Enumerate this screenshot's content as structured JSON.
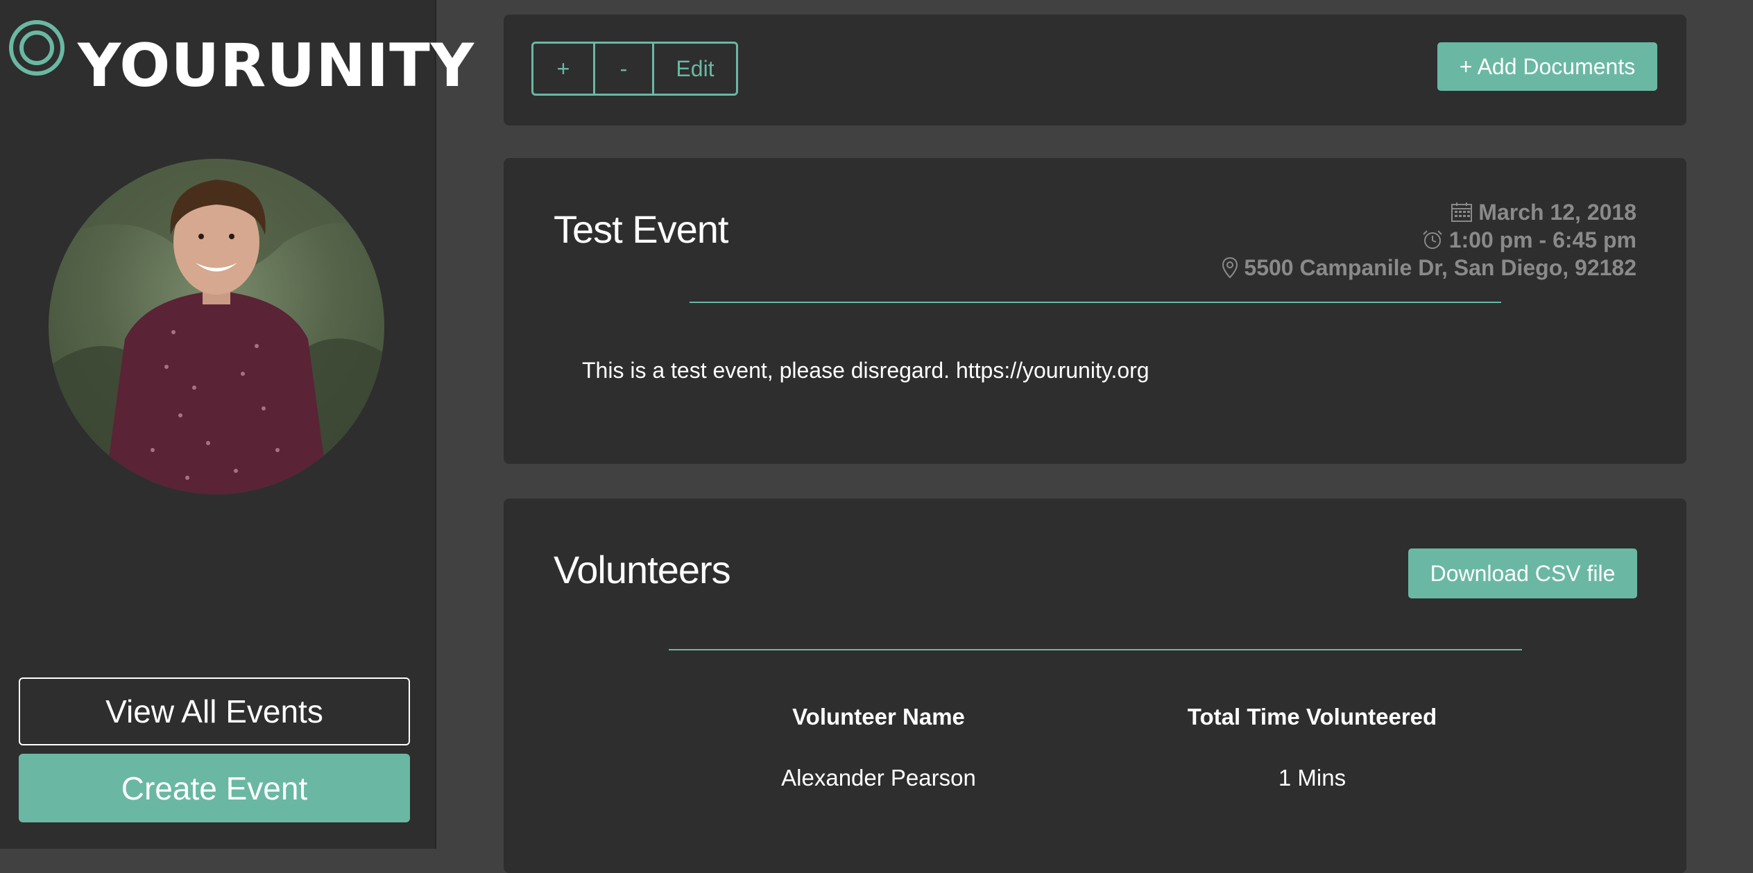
{
  "brand": {
    "logo_text": "YOURUNITY"
  },
  "sidebar": {
    "view_all_label": "View All Events",
    "create_label": "Create Event"
  },
  "toolbar": {
    "plus_label": "+",
    "minus_label": "-",
    "edit_label": "Edit",
    "add_documents_label": "+ Add Documents"
  },
  "event": {
    "title": "Test Event",
    "date": "March 12, 2018",
    "time": "1:00 pm - 6:45 pm",
    "location": "5500 Campanile Dr, San Diego, 92182",
    "description": "This is a test event, please disregard. https://yourunity.org"
  },
  "volunteers": {
    "title": "Volunteers",
    "download_label": "Download CSV file",
    "columns": [
      "Volunteer Name",
      "Total Time Volunteered"
    ],
    "rows": [
      {
        "name": "Alexander Pearson",
        "time": "1 Mins"
      }
    ]
  },
  "colors": {
    "accent": "#6ab8a3",
    "panel": "#2e2e2e",
    "background": "#414141",
    "meta_text": "#8a8a8a"
  }
}
